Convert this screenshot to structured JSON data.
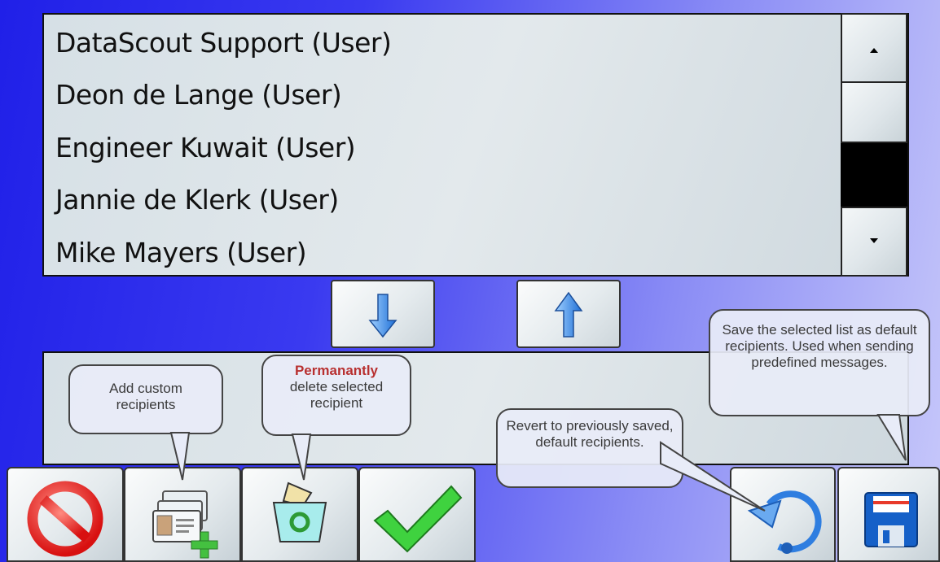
{
  "recipients": [
    "DataScout Support (User)",
    "Deon de Lange (User)",
    "Engineer Kuwait (User)",
    "Jannie de Klerk (User)",
    "Mike Mayers (User)"
  ],
  "callouts": {
    "add": "Add custom recipients",
    "delete_emphasis": "Permanantly",
    "delete_rest": "delete selected recipient",
    "revert": "Revert to previously saved, default recipients.",
    "save": "Save the selected list as default recipients. Used when sending predefined messages."
  },
  "icons": {
    "scroll_up": "triangle-up-icon",
    "scroll_down": "triangle-down-icon",
    "move_down": "arrow-down-icon",
    "move_up": "arrow-up-icon",
    "cancel": "no-entry-icon",
    "add": "contact-cards-add-icon",
    "delete": "recycle-bin-icon",
    "confirm": "checkmark-icon",
    "revert": "undo-arrow-icon",
    "save": "floppy-disk-icon"
  },
  "colors": {
    "cancel_red": "#e8241c",
    "confirm_green": "#2fc02f",
    "arrow_blue": "#3a8ee8",
    "emphasis_red": "#b83030"
  }
}
